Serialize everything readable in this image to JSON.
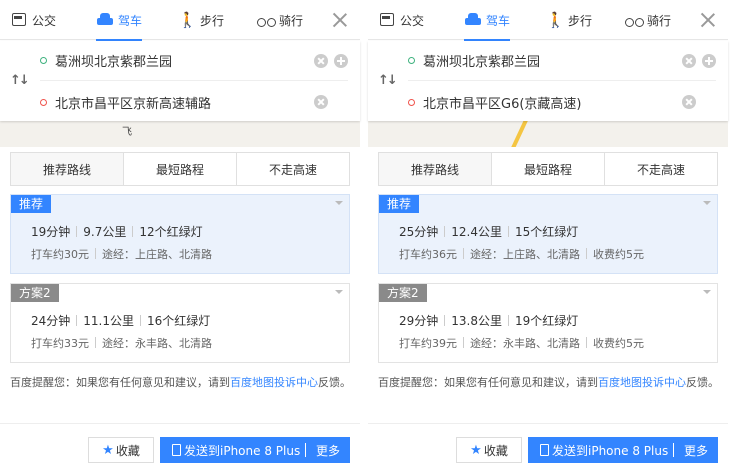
{
  "panels": [
    {
      "modes": [
        "公交",
        "驾车",
        "步行",
        "骑行"
      ],
      "start": "葛洲坝北京紫郡兰园",
      "end": "北京市昌平区京新高速辅路",
      "map_labels": [
        "飞"
      ],
      "strategy_tabs": [
        "推荐路线",
        "最短路程",
        "不走高速"
      ],
      "routes": [
        {
          "tag": "推荐",
          "time": "19分钟",
          "distance": "9.7公里",
          "lights": "12个红绿灯",
          "taxi": "打车约30元",
          "via": "途经：上庄路、北清路",
          "toll": ""
        },
        {
          "tag": "方案2",
          "time": "24分钟",
          "distance": "11.1公里",
          "lights": "16个红绿灯",
          "taxi": "打车约33元",
          "via": "途经：永丰路、北清路",
          "toll": ""
        }
      ],
      "notice_pre": "百度提醒您：如果您有任何意见和建议，请到",
      "notice_link": "百度地图投诉中心",
      "notice_post": "反馈。",
      "fav_label": "收藏",
      "send_label": "发送到iPhone 8 Plus",
      "more_label": "更多"
    },
    {
      "modes": [
        "公交",
        "驾车",
        "步行",
        "骑行"
      ],
      "start": "葛洲坝北京紫郡兰园",
      "end": "北京市昌平区G6(京藏高速)",
      "map_labels": [],
      "strategy_tabs": [
        "推荐路线",
        "最短路程",
        "不走高速"
      ],
      "routes": [
        {
          "tag": "推荐",
          "time": "25分钟",
          "distance": "12.4公里",
          "lights": "15个红绿灯",
          "taxi": "打车约36元",
          "via": "途经：上庄路、北清路",
          "toll": "收费约5元"
        },
        {
          "tag": "方案2",
          "time": "29分钟",
          "distance": "13.8公里",
          "lights": "19个红绿灯",
          "taxi": "打车约39元",
          "via": "途经：永丰路、北清路",
          "toll": "收费约5元"
        }
      ],
      "notice_pre": "百度提醒您：如果您有任何意见和建议，请到",
      "notice_link": "百度地图投诉中心",
      "notice_post": "反馈。",
      "fav_label": "收藏",
      "send_label": "发送到iPhone 8 Plus",
      "more_label": "更多"
    }
  ],
  "colors": {
    "accent": "#3385ff",
    "start_dot": "#3fb27f",
    "end_dot": "#f0544d",
    "selected_bg": "#ebf2fc"
  },
  "icons": [
    "bus-icon",
    "car-icon",
    "walk-icon",
    "bike-icon",
    "close-icon",
    "swap-icon",
    "clear-icon",
    "add-waypoint-icon",
    "star-icon",
    "phone-icon"
  ]
}
